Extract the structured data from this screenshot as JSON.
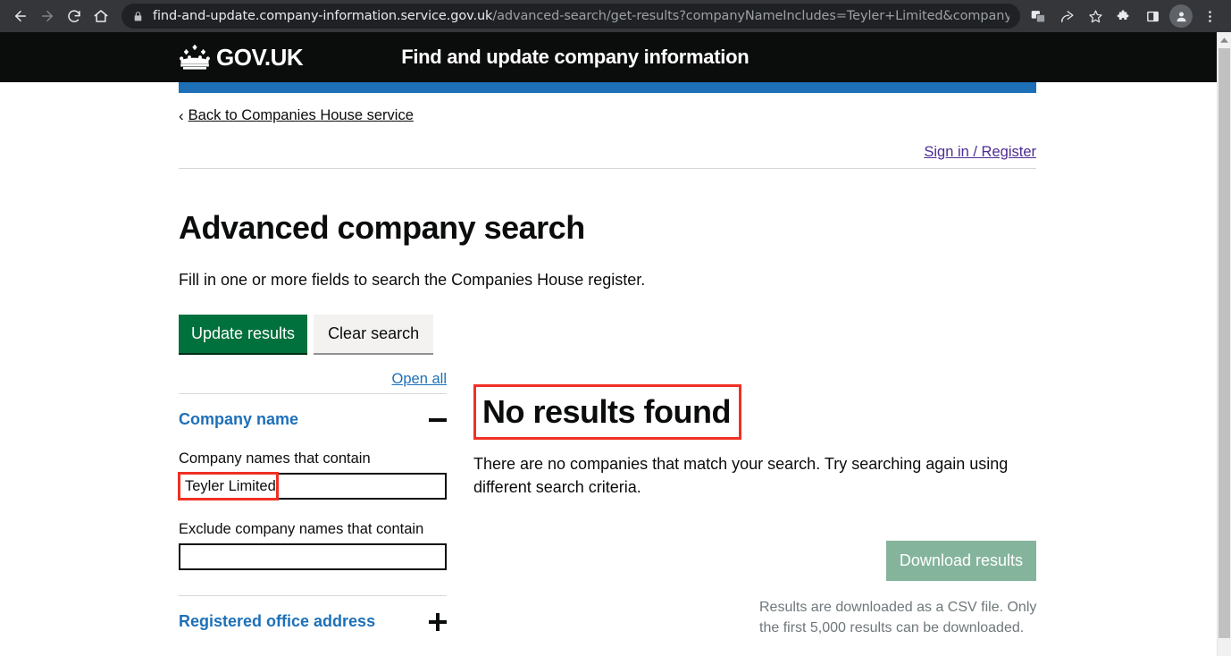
{
  "browser": {
    "url_secure_prefix": "find-and-update.company-information.service.gov.uk",
    "url_path": "/advanced-search/get-results?companyNameIncludes=Teyler+Limited&companyNameE…",
    "icons": {
      "back": "back-arrow-icon",
      "forward": "forward-arrow-icon",
      "reload": "reload-icon",
      "home": "home-icon",
      "lock": "lock-icon",
      "translate": "translate-icon",
      "share": "share-icon",
      "bookmark": "bookmark-star-icon",
      "extensions": "extensions-puzzle-icon",
      "side_panel": "side-panel-icon",
      "profile": "profile-avatar-icon",
      "menu": "three-dot-menu-icon"
    }
  },
  "govuk_header": {
    "crown": "gov-uk-crown-logo",
    "wordmark": "GOV.UK",
    "service_name": "Find and update company information"
  },
  "nav": {
    "back_chevron": "‹",
    "back_link": "Back to Companies House service",
    "sign_in": "Sign in / Register"
  },
  "main": {
    "title": "Advanced company search",
    "intro": "Fill in one or more fields to search the Companies House register.",
    "update_button": "Update results",
    "clear_button": "Clear search"
  },
  "filters": {
    "open_all": "Open all",
    "sections": [
      {
        "title": "Company name",
        "toggle": "minus",
        "expanded": true,
        "fields": [
          {
            "label": "Company names that contain",
            "value": "Teyler Limited",
            "placeholder": "",
            "highlighted": true
          },
          {
            "label": "Exclude company names that contain",
            "value": "",
            "placeholder": "",
            "highlighted": false
          }
        ]
      },
      {
        "title": "Registered office address",
        "toggle": "plus",
        "expanded": false,
        "fields": []
      }
    ]
  },
  "results": {
    "heading": "No results found",
    "heading_highlighted": true,
    "body": "There are no companies that match your search. Try searching again using different search criteria.",
    "download_button": "Download results",
    "download_note": "Results are downloaded as a CSV file. Only the first 5,000 results can be downloaded."
  },
  "colors": {
    "govuk_black": "#0b0c0c",
    "govuk_blue": "#1d70b8",
    "govuk_green": "#00703c",
    "download_disabled_green": "#85b49c",
    "link_purple": "#4c2c92",
    "annotation_red": "#ee3124",
    "grey_text": "#6f777b"
  }
}
